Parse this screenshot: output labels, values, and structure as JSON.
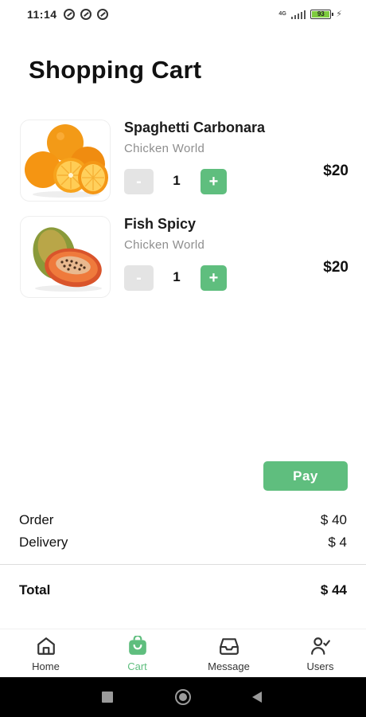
{
  "status": {
    "time": "11:14",
    "network": "4G",
    "battery": "93"
  },
  "page": {
    "title": "Shopping Cart"
  },
  "cart": {
    "items": [
      {
        "name": "Spaghetti Carbonara",
        "vendor": "Chicken World",
        "quantity": "1",
        "price": "$20",
        "minus_label": "-",
        "plus_label": "+",
        "image": "oranges"
      },
      {
        "name": "Fish Spicy",
        "vendor": "Chicken World",
        "quantity": "1",
        "price": "$20",
        "minus_label": "-",
        "plus_label": "+",
        "image": "papaya"
      }
    ]
  },
  "pay": {
    "label": "Pay"
  },
  "summary": {
    "order_label": "Order",
    "order_value": "$ 40",
    "delivery_label": "Delivery",
    "delivery_value": "$ 4",
    "total_label": "Total",
    "total_value": "$ 44"
  },
  "nav": {
    "items": [
      {
        "label": "Home",
        "icon": "home-icon"
      },
      {
        "label": "Cart",
        "icon": "cart-icon",
        "active": true
      },
      {
        "label": "Message",
        "icon": "inbox-icon"
      },
      {
        "label": "Users",
        "icon": "user-check-icon"
      }
    ]
  },
  "colors": {
    "accent": "#5fbe7e",
    "minus_bg": "#e4e4e4",
    "vendor_text": "#8e8e8e"
  }
}
